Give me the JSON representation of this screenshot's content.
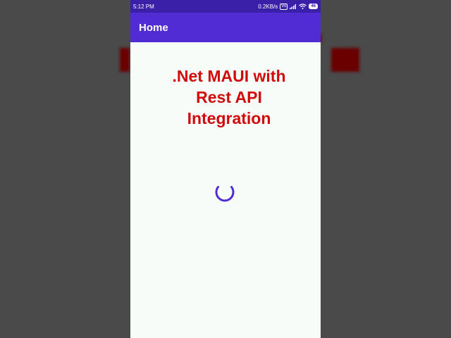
{
  "status_bar": {
    "time": "5:12 PM",
    "speed": "0.2KB/s",
    "sim_badge": "Vo",
    "battery": "46",
    "icons": [
      "signal-icon",
      "wifi-icon",
      "battery-icon"
    ]
  },
  "app_bar": {
    "title": "Home"
  },
  "content": {
    "headline": ".Net MAUI with Rest API Integration",
    "loading_indicator": "activity-indicator-icon"
  },
  "colors": {
    "status_bar": "#3a20a8",
    "app_bar": "#512bd4",
    "headline": "#d10b0b",
    "spinner": "#512bd4",
    "page_background": "#f8fcf9"
  }
}
